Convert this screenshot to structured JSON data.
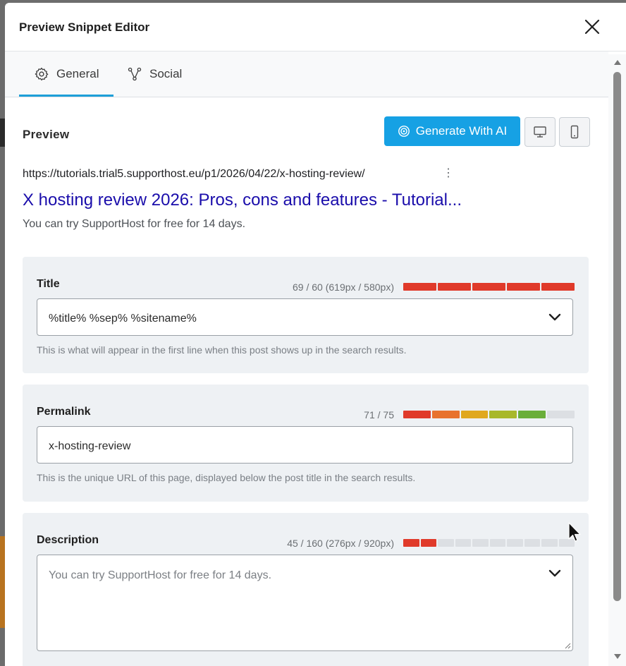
{
  "modal": {
    "title": "Preview Snippet Editor"
  },
  "tabs": [
    {
      "label": "General",
      "icon": "gear-icon",
      "active": true
    },
    {
      "label": "Social",
      "icon": "share-nodes-icon",
      "active": false
    }
  ],
  "preview": {
    "label": "Preview",
    "generate_ai_label": "Generate With AI",
    "accent": "#16a1e4"
  },
  "serp": {
    "url": "https://tutorials.trial5.supporthost.eu/p1/2026/04/22/x-hosting-review/",
    "menu": "⋮",
    "title": "X hosting review 2026: Pros, cons and features - Tutorial...",
    "description": "You can try SupportHost for free for 14 days."
  },
  "title_field": {
    "label": "Title",
    "counter": "69 / 60 (619px / 580px)",
    "value": "%title% %sep% %sitename%",
    "help": "This is what will appear in the first line when this post shows up in the search results.",
    "meter": [
      "#e03a2a",
      "#e03a2a",
      "#e03a2a",
      "#e03a2a",
      "#e03a2a"
    ]
  },
  "permalink_field": {
    "label": "Permalink",
    "counter": "71 / 75",
    "value": "x-hosting-review",
    "help": "This is the unique URL of this page, displayed below the post title in the search results.",
    "meter": [
      "#e03a2a",
      "#e8722d",
      "#e0a81f",
      "#a8b82a",
      "#6aae3a",
      "#dcdfe3"
    ]
  },
  "description_field": {
    "label": "Description",
    "counter": "45 / 160 (276px / 920px)",
    "value": "You can try SupportHost for free for 14 days.",
    "meter": [
      "#e03a2a",
      "#e03a2a",
      "#dcdfe3",
      "#dcdfe3",
      "#dcdfe3",
      "#dcdfe3",
      "#dcdfe3",
      "#dcdfe3",
      "#dcdfe3",
      "#dcdfe3"
    ]
  }
}
